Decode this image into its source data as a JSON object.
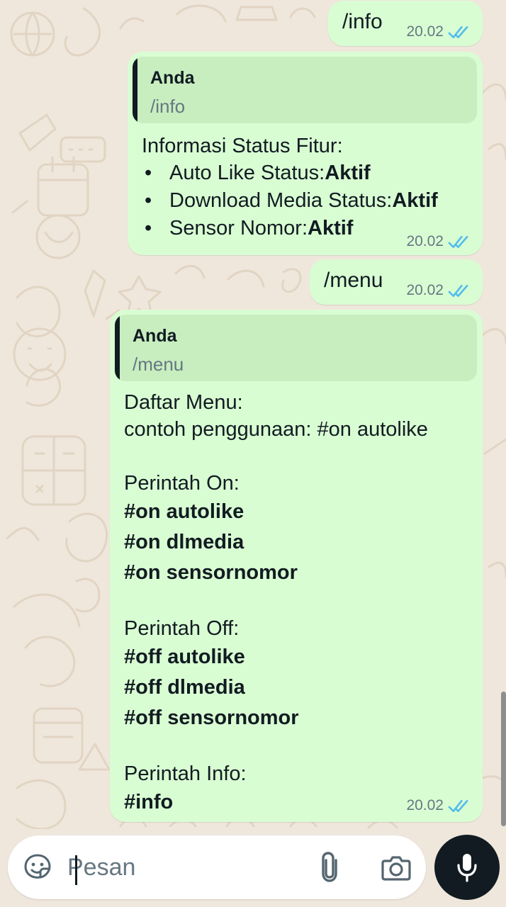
{
  "conversation": {
    "info_command": {
      "text": "/info",
      "time": "20.02",
      "status_icon": "double-check-icon"
    },
    "info_reply": {
      "quoted_author": "Anda",
      "quoted_text": "/info",
      "heading": "Informasi Status Fitur:",
      "items": [
        {
          "bullet": "•",
          "label": "Auto Like Status: ",
          "value": "Aktif"
        },
        {
          "bullet": "•",
          "label": "Download Media Status: ",
          "value": "Aktif"
        },
        {
          "bullet": "•",
          "label": "Sensor Nomor: ",
          "value": "Aktif"
        }
      ],
      "time": "20.02",
      "status_icon": "double-check-icon"
    },
    "menu_command": {
      "text": "/menu",
      "time": "20.02",
      "status_icon": "double-check-icon"
    },
    "menu_reply": {
      "quoted_author": "Anda",
      "quoted_text": "/menu",
      "title": "Daftar Menu:",
      "example": "contoh penggunaan: #on autolike",
      "on_heading": "Perintah On:",
      "on_commands": [
        "#on autolike",
        "#on dlmedia",
        "#on sensornomor"
      ],
      "off_heading": "Perintah Off:",
      "off_commands": [
        "#off autolike",
        "#off dlmedia",
        "#off sensornomor"
      ],
      "info_heading": "Perintah Info:",
      "info_command": "#info",
      "time": "20.02",
      "status_icon": "double-check-icon"
    }
  },
  "composer": {
    "placeholder": "Pesan",
    "value": "",
    "sticker_icon": "sticker-icon",
    "attach_icon": "paperclip-icon",
    "camera_icon": "camera-icon",
    "mic_icon": "microphone-icon"
  },
  "colors": {
    "chat_background": "#efe7dc",
    "outgoing_bubble": "#d9fdd3",
    "quoted_background": "#c8eec0",
    "read_ticks": "#53bdeb",
    "mic_button": "#111b21"
  }
}
